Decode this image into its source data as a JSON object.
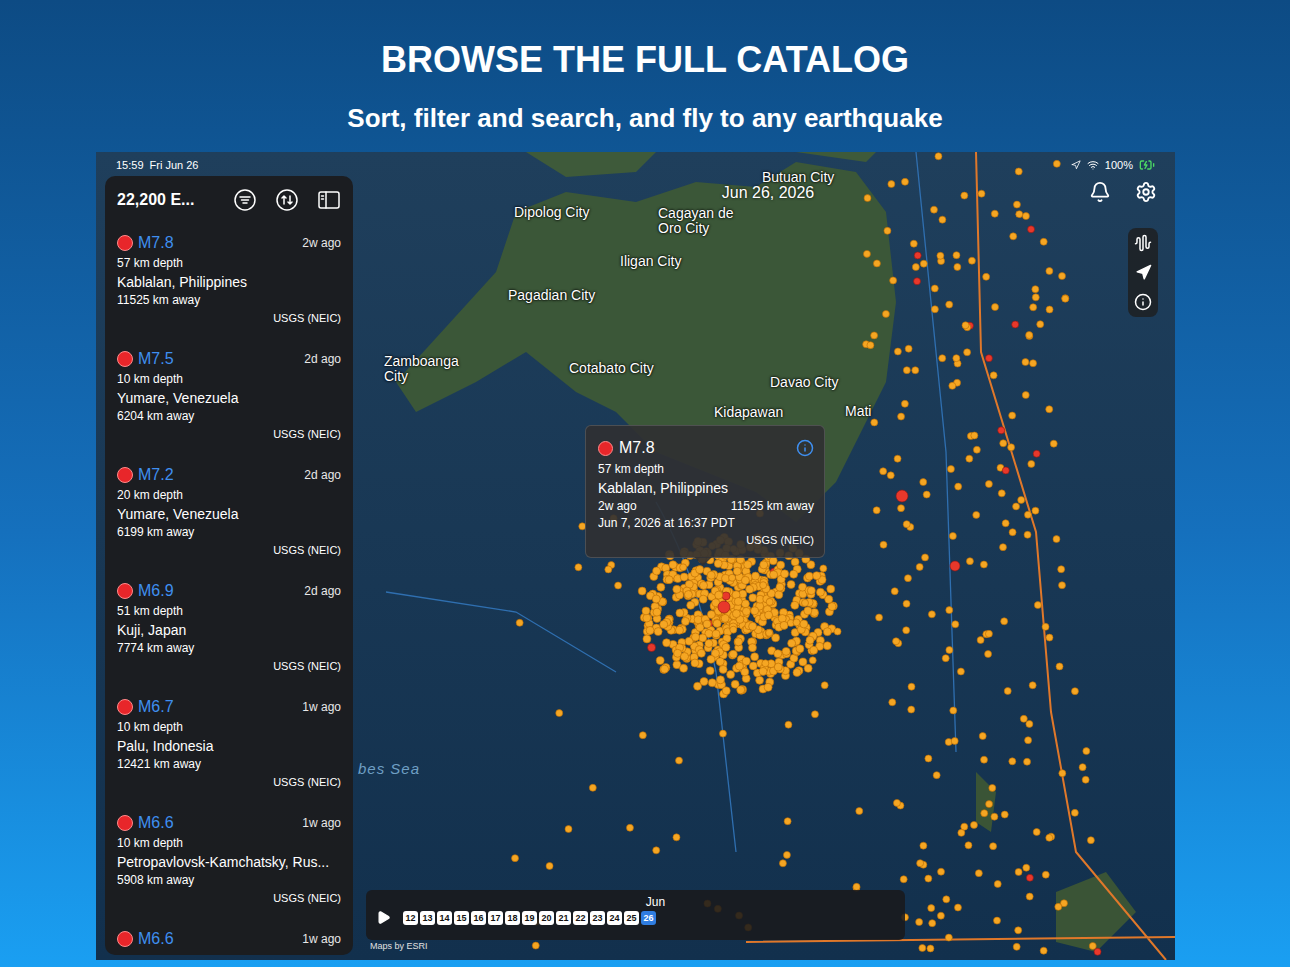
{
  "header": {
    "title": "BROWSE THE FULL CATALOG",
    "subtitle": "Sort, filter and search, and fly to any earthquake"
  },
  "status_bar": {
    "time": "15:59",
    "date": "Fri Jun 26",
    "battery": "100%"
  },
  "panel": {
    "count": "22,200 E...",
    "items": [
      {
        "magnitude": "M7.8",
        "time": "2w ago",
        "depth": "57 km depth",
        "place": "Kablalan, Philippines",
        "distance": "11525 km away",
        "source": "USGS (NEIC)"
      },
      {
        "magnitude": "M7.5",
        "time": "2d ago",
        "depth": "10 km depth",
        "place": "Yumare, Venezuela",
        "distance": "6204 km away",
        "source": "USGS (NEIC)"
      },
      {
        "magnitude": "M7.2",
        "time": "2d ago",
        "depth": "20 km depth",
        "place": "Yumare, Venezuela",
        "distance": "6199 km away",
        "source": "USGS (NEIC)"
      },
      {
        "magnitude": "M6.9",
        "time": "2d ago",
        "depth": "51 km depth",
        "place": "Kuji, Japan",
        "distance": "7774 km away",
        "source": "USGS (NEIC)"
      },
      {
        "magnitude": "M6.7",
        "time": "1w ago",
        "depth": "10 km depth",
        "place": "Palu, Indonesia",
        "distance": "12421 km away",
        "source": "USGS (NEIC)"
      },
      {
        "magnitude": "M6.6",
        "time": "1w ago",
        "depth": "10 km depth",
        "place": "Petropavlovsk-Kamchatsky, Rus...",
        "distance": "5908 km away",
        "source": "USGS (NEIC)"
      },
      {
        "magnitude": "M6.6",
        "time": "1w ago"
      }
    ]
  },
  "map": {
    "date_label": "Jun 26, 2026",
    "labels": [
      {
        "text": "Butuan City"
      },
      {
        "text": "Dipolog City"
      },
      {
        "text": "Cagayan de Oro City"
      },
      {
        "text": "Iligan City"
      },
      {
        "text": "Pagadian City"
      },
      {
        "text": "Zamboanga City"
      },
      {
        "text": "Cotabato City"
      },
      {
        "text": "Davao City"
      },
      {
        "text": "Kidapawan"
      },
      {
        "text": "Mati"
      }
    ],
    "sea_label": "bes Sea",
    "attribution": "Maps by ESRI"
  },
  "tooltip": {
    "magnitude": "M7.8",
    "depth": "57 km depth",
    "place": "Kablalan, Philippines",
    "time": "2w ago",
    "distance": "11525 km away",
    "datetime": "Jun 7, 2026 at 16:37 PDT",
    "source": "USGS (NEIC)"
  },
  "timeline": {
    "month": "Jun",
    "days": [
      {
        "label": "12",
        "selected": false
      },
      {
        "label": "13",
        "selected": false
      },
      {
        "label": "14",
        "selected": false
      },
      {
        "label": "15",
        "selected": false
      },
      {
        "label": "16",
        "selected": false
      },
      {
        "label": "17",
        "selected": false
      },
      {
        "label": "18",
        "selected": false
      },
      {
        "label": "19",
        "selected": false
      },
      {
        "label": "20",
        "selected": false
      },
      {
        "label": "21",
        "selected": false
      },
      {
        "label": "22",
        "selected": false
      },
      {
        "label": "23",
        "selected": false
      },
      {
        "label": "24",
        "selected": false
      },
      {
        "label": "25",
        "selected": false
      },
      {
        "label": "26",
        "selected": true
      }
    ]
  }
}
